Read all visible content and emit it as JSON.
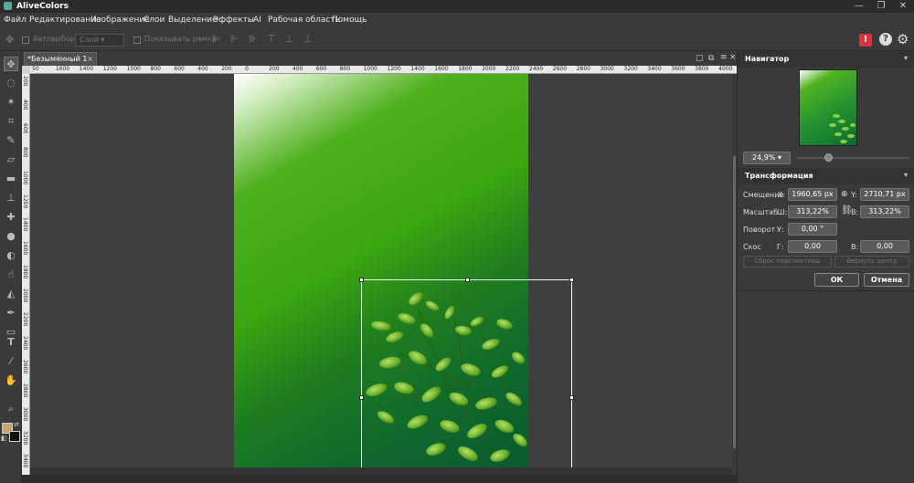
{
  "app": {
    "title": "AliveColors"
  },
  "menu": {
    "items": [
      "Файл",
      "Редактирование",
      "Изображение",
      "Слои",
      "Выделение",
      "Эффекты",
      "AI",
      "Рабочая область",
      "Помощь"
    ]
  },
  "options": {
    "autoselect_label": "Автовыбор",
    "layer_select": "Слой",
    "show_frame_label": "Показывать рамку"
  },
  "document": {
    "tab_title": "*Безымянный 1",
    "close": "×"
  },
  "ruler": {
    "h_ticks": [
      "50",
      "1600",
      "1400",
      "1200",
      "1000",
      "800",
      "600",
      "400",
      "200",
      "0",
      "200",
      "400",
      "600",
      "800",
      "1000",
      "1200",
      "1400",
      "1600",
      "1800",
      "2000",
      "2200",
      "2400",
      "2600",
      "2800",
      "3000",
      "3200",
      "3400",
      "3600",
      "3800",
      "4000",
      "4200"
    ],
    "v_ticks": [
      "200",
      "400",
      "600",
      "800",
      "1000",
      "1200",
      "1400",
      "1600",
      "1800",
      "2000",
      "2200",
      "2400",
      "2600",
      "2800",
      "3000",
      "3200",
      "3400",
      "3600"
    ]
  },
  "navigator": {
    "title": "Навигатор",
    "zoom": "24,9%",
    "zoom_fraction": 0.2
  },
  "transform": {
    "title": "Трансформация",
    "offset_label": "Смещение",
    "x_label": "X:",
    "x_value": "1960,65 px",
    "y_label": "Y:",
    "y_value": "2710,71 px",
    "scale_label": "Масштаб",
    "w_label": "Ш:",
    "w_value": "313,22%",
    "h_label": "В:",
    "h_value": "313,22%",
    "rotate_label": "Поворот",
    "u_label": "У:",
    "u_value": "0,00 °",
    "skew_label": "Скос",
    "g_label": "Г:",
    "g_value": "0,00",
    "v_label": "В:",
    "v_value": "0,00",
    "reset_perspective": "Сброс перспективы",
    "return_center": "Вернуть центр",
    "ok": "ОК",
    "cancel": "Отмена"
  },
  "colors": {
    "foreground": "#c8a96a",
    "background": "#111111",
    "accent_alert": "#d9333b"
  }
}
